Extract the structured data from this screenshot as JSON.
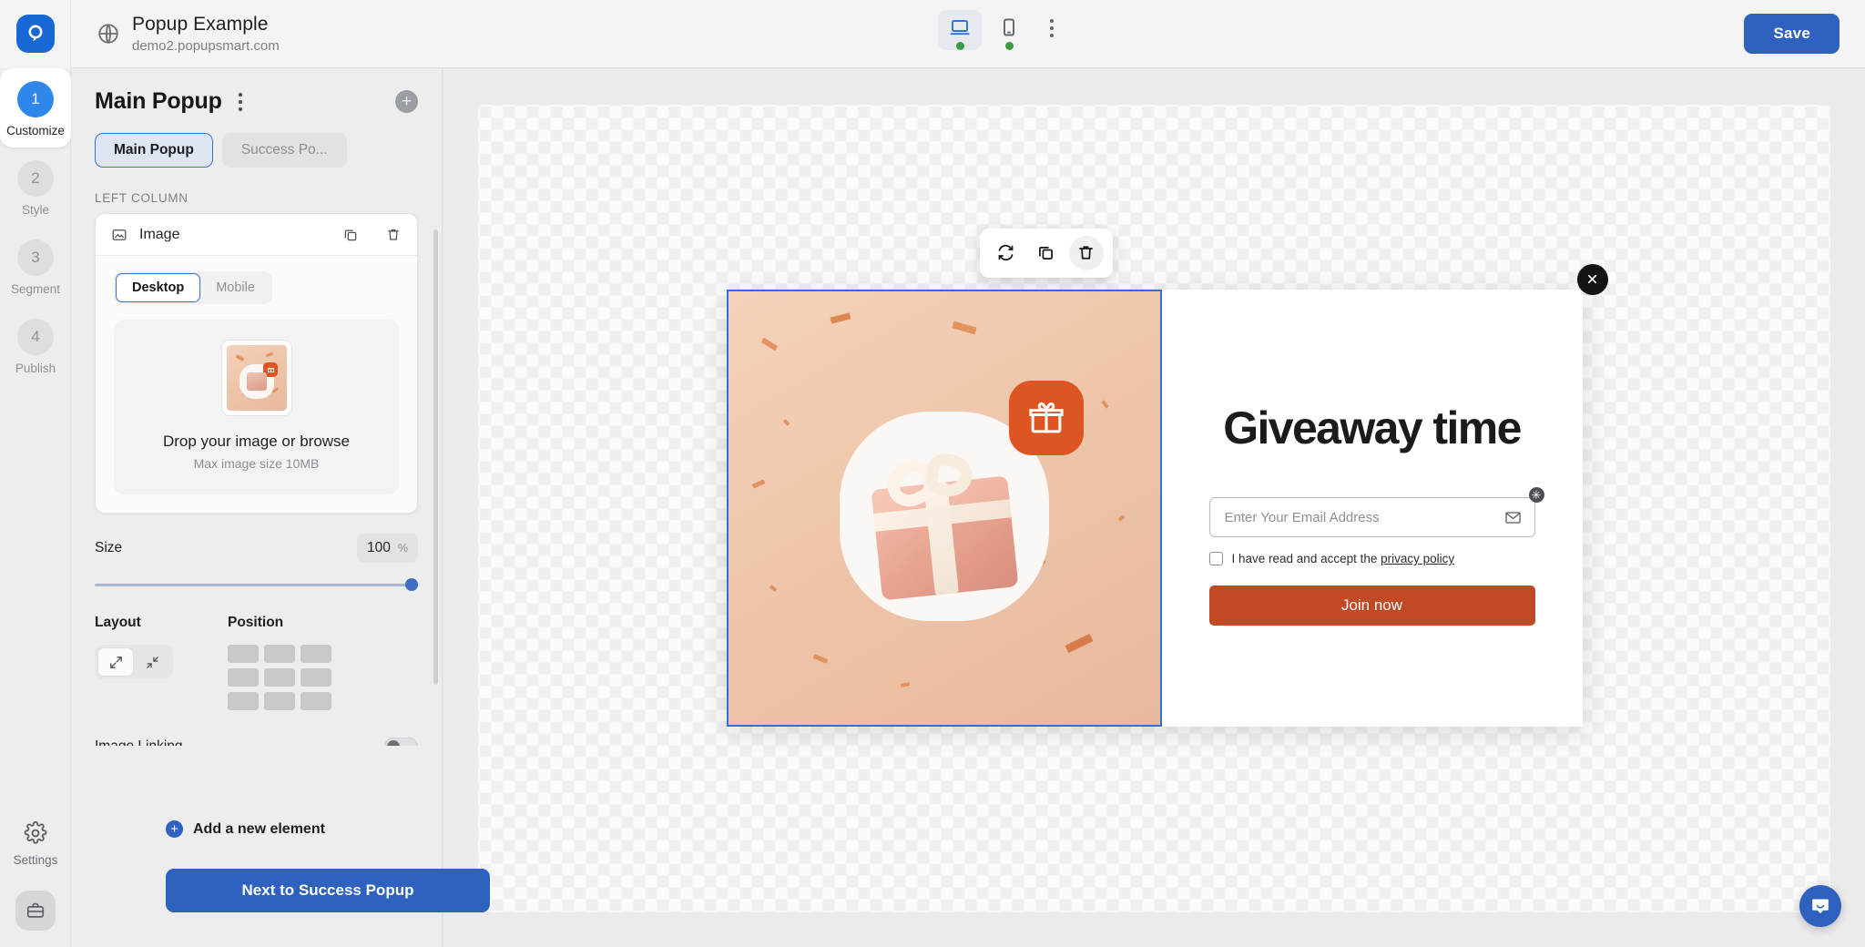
{
  "topbar": {
    "logo_icon": "popupsmart-logo-icon",
    "globe_icon": "globe-icon",
    "site_title": "Popup Example",
    "site_url": "demo2.popupsmart.com",
    "devices": [
      {
        "icon": "desktop-icon",
        "name": "desktop",
        "active": true,
        "status": "online"
      },
      {
        "icon": "mobile-icon",
        "name": "mobile",
        "active": false,
        "status": "online"
      }
    ],
    "kebab_icon": "more-vertical-icon",
    "save_label": "Save",
    "save_color": "#2f62bf"
  },
  "rail": {
    "steps": [
      {
        "num": "1",
        "label": "Customize",
        "active": true
      },
      {
        "num": "2",
        "label": "Style",
        "active": false
      },
      {
        "num": "3",
        "label": "Segment",
        "active": false
      },
      {
        "num": "4",
        "label": "Publish",
        "active": false
      }
    ],
    "settings_label": "Settings",
    "settings_icon": "gear-icon",
    "case_icon": "briefcase-icon"
  },
  "panel": {
    "title": "Main Popup",
    "kebab_icon": "more-vertical-icon",
    "add_icon": "plus-circle-icon",
    "tabs": [
      {
        "label": "Main Popup",
        "active": true
      },
      {
        "label": "Success Po...",
        "active": false
      }
    ],
    "column_label": "LEFT COLUMN",
    "element": {
      "icon": "image-icon",
      "name": "Image",
      "copy_icon": "duplicate-icon",
      "delete_icon": "trash-icon",
      "view_tabs": [
        {
          "label": "Desktop",
          "active": true
        },
        {
          "label": "Mobile",
          "active": false
        }
      ],
      "dropzone_title": "Drop your image or browse",
      "dropzone_sub": "Max image size 10MB",
      "size_label": "Size",
      "size_value": "100",
      "size_unit": "%",
      "layout_label": "Layout",
      "layout_options": [
        {
          "icon": "expand-icon",
          "active": true
        },
        {
          "icon": "collapse-icon",
          "active": false
        }
      ],
      "position_label": "Position",
      "position_cells": 9,
      "image_linking_label": "Image Linking",
      "image_linking_on": false
    },
    "add_element_label": "Add a new element",
    "next_label": "Next to Success Popup"
  },
  "canvas": {
    "toolbar": [
      {
        "icon": "replace-icon",
        "name": "replace-image",
        "hover": false
      },
      {
        "icon": "duplicate-icon",
        "name": "duplicate-element",
        "hover": false
      },
      {
        "icon": "trash-icon",
        "name": "delete-element",
        "hover": true
      }
    ],
    "popup": {
      "close_icon": "close-icon",
      "title": "Giveaway time",
      "email_placeholder": "Enter Your Email Address",
      "email_value": "",
      "mail_icon": "envelope-icon",
      "required_badge": "✳",
      "consent_prefix": "I have read and accept the ",
      "consent_link": "privacy policy",
      "consent_checked": false,
      "cta_label": "Join now",
      "cta_color": "#c14a24",
      "image_alt": "gift-box-illustration",
      "badge_icon": "gift-icon"
    }
  },
  "intercom": {
    "icon": "chat-bubble-icon",
    "color": "#2f62bf"
  }
}
